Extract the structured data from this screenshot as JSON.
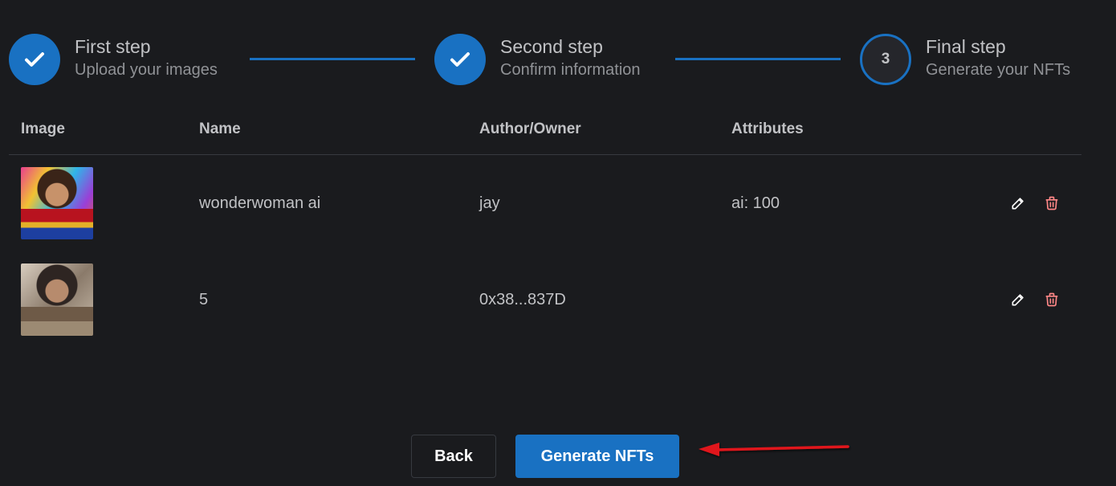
{
  "stepper": {
    "steps": [
      {
        "title": "First step",
        "description": "Upload your images",
        "status": "completed",
        "icon": "check-icon"
      },
      {
        "title": "Second step",
        "description": "Confirm information",
        "status": "completed",
        "icon": "check-icon"
      },
      {
        "title": "Final step",
        "description": "Generate your NFTs",
        "status": "active",
        "number": "3"
      }
    ]
  },
  "table": {
    "headers": [
      "Image",
      "Name",
      "Author/Owner",
      "Attributes"
    ],
    "rows": [
      {
        "image": "wonderwoman-colorful-thumbnail",
        "name": "wonderwoman ai",
        "author": "jay",
        "attributes": "ai: 100"
      },
      {
        "image": "wonderwoman-sepia-thumbnail",
        "name": "5",
        "author": "0x38...837D",
        "attributes": ""
      }
    ],
    "row_actions": [
      "pencil-icon",
      "trash-icon"
    ]
  },
  "buttons": {
    "back_label": "Back",
    "generate_label": "Generate NFTs"
  },
  "annotation": {
    "arrow_color": "#e0151b",
    "points_to": "generate-nfts-button"
  },
  "colors": {
    "background": "#1a1b1e",
    "accent": "#1971c2",
    "text": "#c1c2c5",
    "muted_text": "#909296",
    "danger_icon": "#ff8787"
  }
}
